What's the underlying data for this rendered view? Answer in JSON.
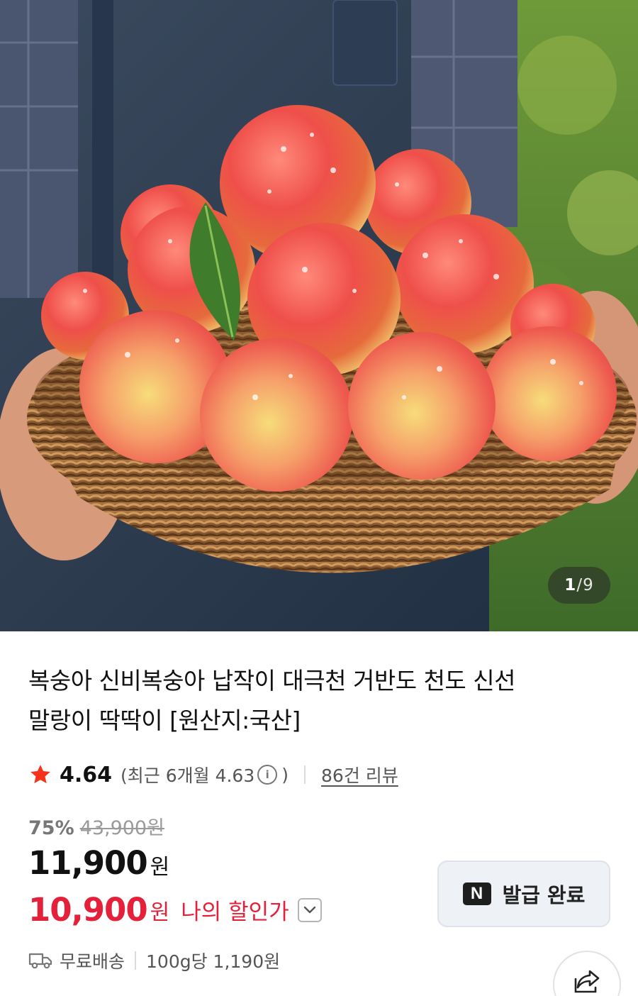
{
  "gallery": {
    "current": "1",
    "separator": "/",
    "total": "9"
  },
  "product": {
    "title_line1": "복숭아 신비복숭아 납작이 대극천 거반도 천도 신선",
    "title_line2": "말랑이 딱딱이 [원산지:국산]"
  },
  "rating": {
    "score": "4.64",
    "recent_prefix": "(최근 6개월 4.63",
    "recent_suffix": ")",
    "info_glyph": "i",
    "reviews": "86건 리뷰"
  },
  "pricing": {
    "discount_rate": "75%",
    "original_price": "43,900원",
    "price": "11,900",
    "price_unit": "원",
    "my_price": "10,900",
    "my_price_unit": "원",
    "my_price_label": "나의 할인가"
  },
  "coupon": {
    "icon_text": "N",
    "label": "발급 완료"
  },
  "shipping": {
    "label": "무료배송",
    "unit_price": "100g당 1,190원"
  },
  "colors": {
    "accent_red": "#e5203b",
    "star": "#f5331c"
  },
  "icons": {
    "star": "star-icon",
    "info": "info-icon",
    "truck": "truck-icon",
    "share": "share-icon",
    "chevron": "chevron-down-icon",
    "naver": "naver-n-icon"
  }
}
